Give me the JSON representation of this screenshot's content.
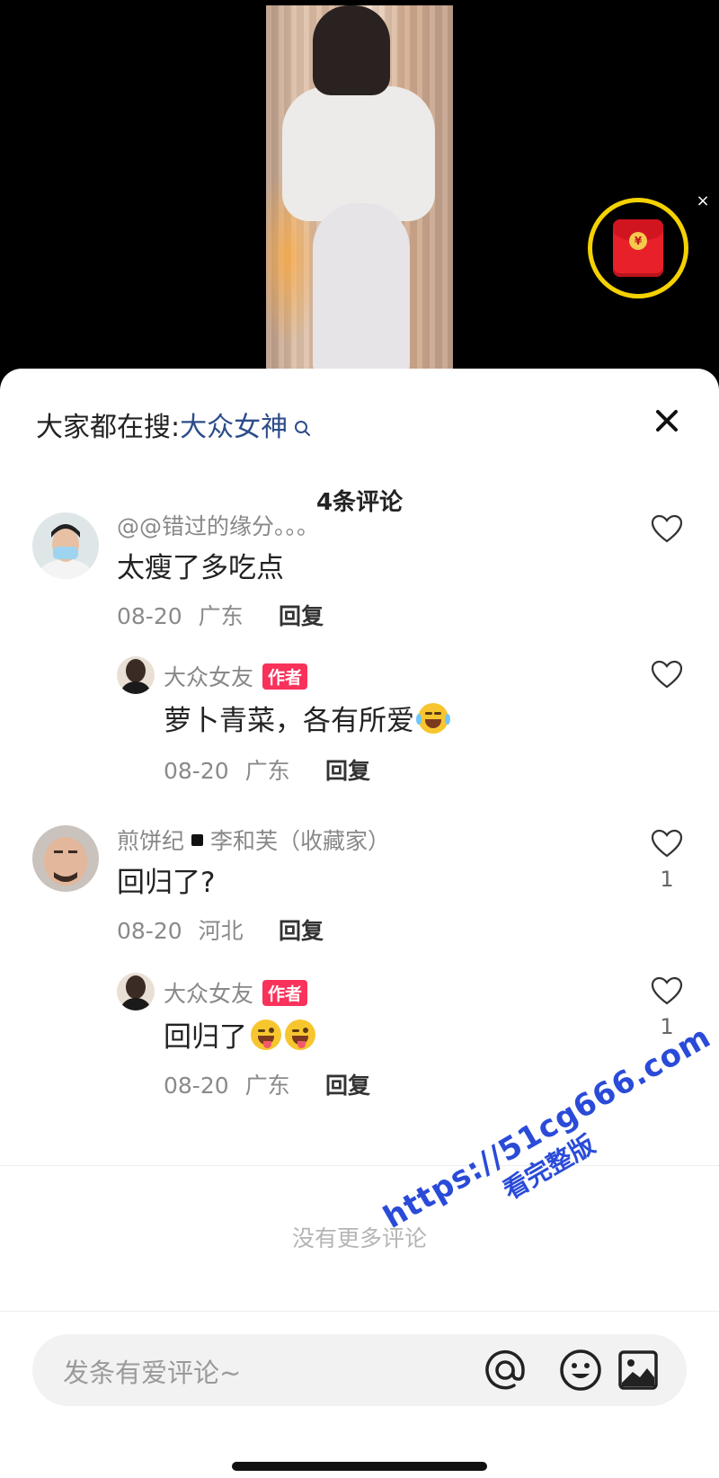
{
  "search": {
    "prefix": "大家都在搜:",
    "keyword": "大众女神"
  },
  "comments_header": {
    "count_label": "4条评论"
  },
  "comments": [
    {
      "user": "@@错过的缘分。。。",
      "text": "太瘦了多吃点",
      "date": "08-20",
      "location": "广东",
      "reply_label": "回复",
      "likes": "",
      "reply": {
        "user": "大众女友",
        "badge": "作者",
        "text": "萝卜青菜，各有所爱",
        "emoji": "face-with-tears-of-joy",
        "date": "08-20",
        "location": "广东",
        "reply_label": "回复",
        "likes": ""
      }
    },
    {
      "user_part1": "煎饼纪",
      "user_part2": "李和芙（收藏家）",
      "text": "回归了?",
      "date": "08-20",
      "location": "河北",
      "reply_label": "回复",
      "likes": "1",
      "reply": {
        "user": "大众女友",
        "badge": "作者",
        "text": "回归了",
        "emoji": "winking-face-with-tongue",
        "date": "08-20",
        "location": "广东",
        "reply_label": "回复",
        "likes": "1"
      }
    }
  ],
  "footer": {
    "no_more": "没有更多评论"
  },
  "input": {
    "placeholder": "发条有爱评论~"
  },
  "watermark": {
    "line1": "https://51cg666.com",
    "line2": "看完整版"
  },
  "colors": {
    "author_badge": "#f8325b",
    "search_keyword": "#2c4d8a",
    "redpacket_ring": "#f4d200"
  }
}
